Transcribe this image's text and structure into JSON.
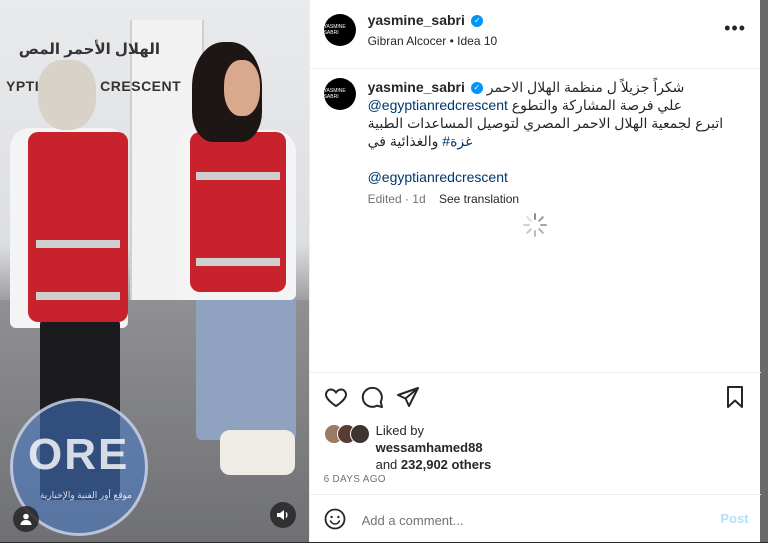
{
  "header": {
    "username": "yasmine_sabri",
    "subtitle": "Gibran Alcocer • Idea 10",
    "avatar_text": "YASMINE SABRI",
    "more_icon": "more-horizontal-icon"
  },
  "media": {
    "sign_arabic": "الهلال الأحمر المص",
    "sign_english": "YPTIAN RED CRESCENT",
    "watermark_text": "ORE",
    "watermark_sub": "موقع أور الفنية والإخبارية"
  },
  "caption": {
    "username": "yasmine_sabri",
    "line1": "شكراً جزيلاً ل منظمة الهلال الاحمر",
    "line2_mention": "@egyptianredcrescent",
    "line2_text": "علي فرصة المشاركة والتطوع",
    "line3": "اتبرع لجمعية الهلال الاحمر المصري لتوصيل المساعدات الطبية",
    "line4_text": "والغذائية في",
    "line4_hashtag": "#غزة",
    "mention_line": "@egyptianredcrescent",
    "edited": "Edited · 1d",
    "see_translation": "See translation"
  },
  "actions": {
    "like_icon": "heart-icon",
    "comment_icon": "comment-icon",
    "share_icon": "send-icon",
    "save_icon": "bookmark-icon"
  },
  "likes": {
    "liked_by_label": "Liked by",
    "liked_by_user": "wessamhamed88",
    "others_prefix": "and",
    "others_count": "232,902 others"
  },
  "date": "6 DAYS AGO",
  "comment": {
    "placeholder": "Add a comment...",
    "post_label": "Post"
  }
}
